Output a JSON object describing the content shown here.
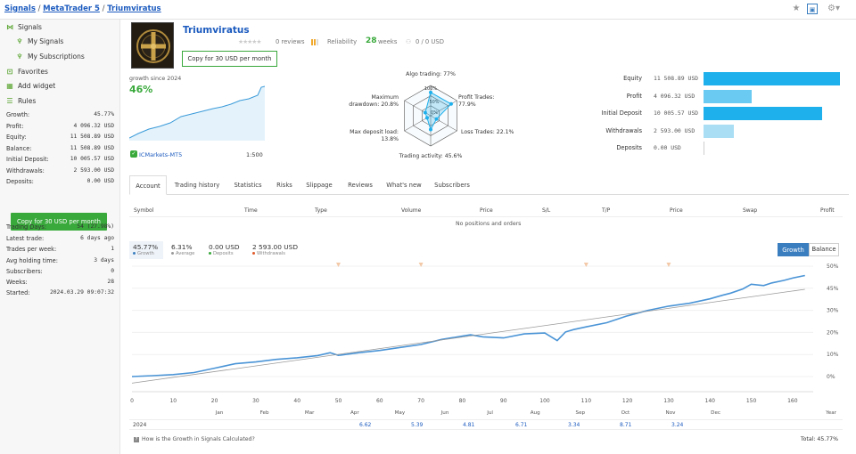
{
  "breadcrumb": [
    "Signals",
    "MetaTrader 5",
    "Triumviratus"
  ],
  "sidebar": {
    "nav": [
      {
        "label": "Signals",
        "icon": "signals-icon"
      },
      {
        "label": "My Signals",
        "icon": "my-signals-icon"
      },
      {
        "label": "My Subscriptions",
        "icon": "subscriptions-icon"
      },
      {
        "label": "Favorites",
        "icon": "star-icon"
      },
      {
        "label": "Add widget",
        "icon": "widget-icon"
      },
      {
        "label": "Rules",
        "icon": "rules-icon"
      }
    ],
    "stats": [
      {
        "label": "Growth:",
        "value": "45.77%"
      },
      {
        "label": "Profit:",
        "value": "4 096.32 USD"
      },
      {
        "label": "Equity:",
        "value": "11 508.89 USD"
      },
      {
        "label": "Balance:",
        "value": "11 508.89 USD"
      },
      {
        "label": "Initial Deposit:",
        "value": "10 005.57 USD"
      },
      {
        "label": "Withdrawals:",
        "value": "2 593.00 USD"
      },
      {
        "label": "Deposits:",
        "value": "0.00 USD"
      }
    ],
    "copy_button": "Copy for 30 USD per month",
    "info": [
      {
        "label": "Trading Days:",
        "value": "54 (27.98%)"
      },
      {
        "label": "Latest trade:",
        "value": "6 days ago"
      },
      {
        "label": "Trades per week:",
        "value": "1"
      },
      {
        "label": "Avg holding time:",
        "value": "3 days"
      },
      {
        "label": "Subscribers:",
        "value": "0"
      },
      {
        "label": "Weeks:",
        "value": "28"
      },
      {
        "label": "Started:",
        "value": "2024.03.29 09:07:32"
      }
    ]
  },
  "header": {
    "title": "Triumviratus",
    "reviews": "0 reviews",
    "reliability": "Reliability",
    "weeks": "28",
    "weeks_label": "weeks",
    "copies": "0 / 0 USD",
    "copy_button": "Copy for 30 USD per month"
  },
  "growth_mini": {
    "label": "growth since 2024",
    "value": "46%",
    "broker": "ICMarkets-MT5",
    "leverage": "1:500"
  },
  "radar": {
    "algo": "Algo trading: 77%",
    "profit_trades": "Profit Trades:",
    "profit_trades_val": "77.9%",
    "loss_trades": "Loss Trades: 22.1%",
    "activity": "Trading activity: 45.6%",
    "max_dd": "Max deposit load:",
    "max_dd_val": "13.8%",
    "drawdown": "Maximum",
    "drawdown2": "drawdown: 20.8%",
    "ring_labels": [
      "100%",
      "50%",
      "0%"
    ],
    "values": [
      0.77,
      0.779,
      0.221,
      0.456,
      0.138,
      0.208
    ]
  },
  "summary_bars": [
    {
      "label": "Equity",
      "value": "11 508.89 USD",
      "amount": 11508.89,
      "color": "#1eb0ec"
    },
    {
      "label": "Profit",
      "value": "4 096.32 USD",
      "amount": 4096.32,
      "color": "#6bcaf1"
    },
    {
      "label": "Initial Deposit",
      "value": "10 005.57 USD",
      "amount": 10005.57,
      "color": "#1eb0ec"
    },
    {
      "label": "Withdrawals",
      "value": "2 593.00 USD",
      "amount": 2593.0,
      "color": "#a9def5"
    },
    {
      "label": "Deposits",
      "value": "0.00 USD",
      "amount": 0,
      "color": "#1eb0ec"
    }
  ],
  "tabs": [
    "Account",
    "Trading history",
    "Statistics",
    "Risks",
    "Slippage",
    "Reviews",
    "What's new",
    "Subscribers"
  ],
  "table_headers": [
    "Symbol",
    "Time",
    "Type",
    "Volume",
    "Price",
    "S/L",
    "T/P",
    "Price",
    "Swap",
    "Profit"
  ],
  "no_positions": "No positions and orders",
  "chips": [
    {
      "value": "45.77%",
      "label": "Growth",
      "color": "#3b7ec0"
    },
    {
      "value": "6.31%",
      "label": "Average",
      "color": "#9a9a9a"
    },
    {
      "value": "0.00 USD",
      "label": "Deposits",
      "color": "#39a93b"
    },
    {
      "value": "2 593.00 USD",
      "label": "Withdrawals",
      "color": "#e05a2b"
    }
  ],
  "chart_buttons": {
    "growth": "Growth",
    "balance": "Balance"
  },
  "chart_data": {
    "type": "line",
    "x_ticks": [
      "0",
      "10",
      "20",
      "30",
      "40",
      "50",
      "60",
      "70",
      "80",
      "90",
      "100",
      "110",
      "120",
      "130",
      "140",
      "150",
      "160"
    ],
    "months": [
      "Jan",
      "Feb",
      "Mar",
      "Apr",
      "May",
      "Jun",
      "Jul",
      "Aug",
      "Sep",
      "Oct",
      "Nov",
      "Dec",
      "Year"
    ],
    "y_ticks": [
      "50%",
      "45%",
      "30%",
      "20%",
      "10%",
      "0%"
    ],
    "ylim": [
      -5,
      50
    ],
    "xlim": [
      0,
      165
    ],
    "series": [
      {
        "name": "Growth",
        "x": [
          0,
          5,
          10,
          15,
          20,
          25,
          30,
          35,
          40,
          45,
          48,
          50,
          55,
          60,
          65,
          70,
          75,
          80,
          82,
          85,
          90,
          95,
          100,
          103,
          105,
          107,
          110,
          115,
          120,
          125,
          130,
          135,
          140,
          143,
          145,
          148,
          150,
          153,
          155,
          158,
          160,
          163
        ],
        "y": [
          0,
          0.4,
          0.9,
          1.8,
          3.8,
          5.8,
          6.6,
          7.8,
          8.5,
          9.5,
          10.8,
          9.6,
          10.8,
          11.8,
          13.2,
          14.5,
          16.8,
          18.3,
          18.9,
          18.0,
          17.5,
          19.3,
          19.7,
          16.3,
          20.2,
          21.3,
          22.5,
          24.4,
          27.5,
          30.0,
          31.9,
          33.2,
          35.2,
          36.8,
          37.8,
          39.7,
          41.8,
          41.2,
          42.4,
          43.6,
          44.6,
          45.77
        ]
      },
      {
        "name": "Average",
        "x": [
          0,
          163
        ],
        "y": [
          -3,
          39.5
        ]
      }
    ],
    "markers_x": [
      50,
      70,
      110,
      130
    ]
  },
  "year_row": {
    "year": "2024",
    "values": [
      "6.62",
      "5.39",
      "4.81",
      "6.71",
      "3.34",
      "8.71",
      "3.24"
    ]
  },
  "footer": {
    "help": "How is the Growth in Signals Calculated?",
    "total": "Total: 45.77%"
  }
}
